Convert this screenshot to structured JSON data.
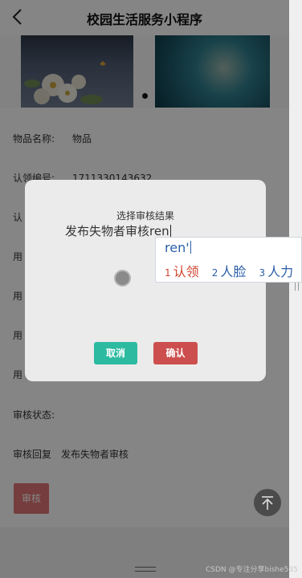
{
  "nav": {
    "title": "校园生活服务小程序"
  },
  "form": {
    "rows": [
      {
        "label": "物品名称:",
        "value": "物品"
      },
      {
        "label": "认领编号:",
        "value": "1711330143632"
      },
      {
        "label": "认",
        "value": ""
      },
      {
        "label": "用",
        "value": ""
      },
      {
        "label": "用",
        "value": ""
      },
      {
        "label": "用",
        "value": ""
      },
      {
        "label": "用",
        "value": ""
      },
      {
        "label": "审核状态:",
        "value": ""
      },
      {
        "label": "审核回复",
        "value": "发布失物者审核"
      }
    ],
    "audit_button": "审核"
  },
  "modal": {
    "title": "选择审核结果",
    "input_text": "发布失物者审核ren",
    "cancel_label": "取消",
    "confirm_label": "确认"
  },
  "ime": {
    "composition": "ren'",
    "candidates": [
      {
        "num": "1",
        "text": "认领"
      },
      {
        "num": "2",
        "text": "人脸"
      },
      {
        "num": "3",
        "text": "人力"
      }
    ]
  },
  "watermark": "CSDN @专注分享bishe535"
}
